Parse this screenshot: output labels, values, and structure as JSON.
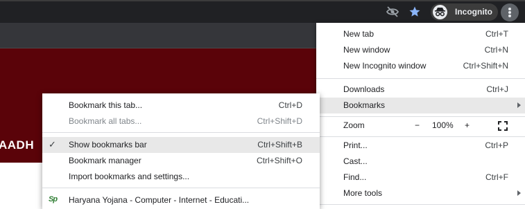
{
  "toolbar": {
    "profile_label": "Incognito"
  },
  "page": {
    "banner_text": "AADH"
  },
  "menu": {
    "new_tab": {
      "label": "New tab",
      "shortcut": "Ctrl+T"
    },
    "new_window": {
      "label": "New window",
      "shortcut": "Ctrl+N"
    },
    "new_incognito": {
      "label": "New Incognito window",
      "shortcut": "Ctrl+Shift+N"
    },
    "downloads": {
      "label": "Downloads",
      "shortcut": "Ctrl+J"
    },
    "bookmarks": {
      "label": "Bookmarks"
    },
    "zoom": {
      "label": "Zoom",
      "minus": "−",
      "value": "100%",
      "plus": "+"
    },
    "print": {
      "label": "Print...",
      "shortcut": "Ctrl+P"
    },
    "cast": {
      "label": "Cast..."
    },
    "find": {
      "label": "Find...",
      "shortcut": "Ctrl+F"
    },
    "more_tools": {
      "label": "More tools"
    }
  },
  "bookmarks_menu": {
    "bookmark_tab": {
      "label": "Bookmark this tab...",
      "shortcut": "Ctrl+D"
    },
    "bookmark_all": {
      "label": "Bookmark all tabs...",
      "shortcut": "Ctrl+Shift+D"
    },
    "show_bar": {
      "label": "Show bookmarks bar",
      "shortcut": "Ctrl+Shift+B",
      "checked": true
    },
    "manager": {
      "label": "Bookmark manager",
      "shortcut": "Ctrl+Shift+O"
    },
    "import": {
      "label": "Import bookmarks and settings..."
    },
    "saved": [
      {
        "label": "Haryana Yojana - Computer - Internet - Educati...",
        "favicon_text": "Sp"
      }
    ]
  },
  "colors": {
    "chrome_dark": "#202124",
    "banner": "#5a0309",
    "star_accent": "#8ab4f8",
    "highlight": "#e8e8e8"
  }
}
